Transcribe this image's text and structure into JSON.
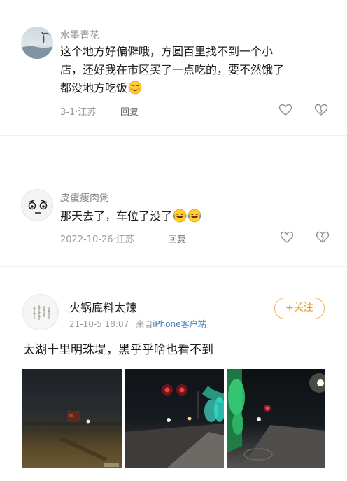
{
  "comments": [
    {
      "username": "水墨青花",
      "text_line1": "这个地方好偏僻哦，方圆百里找不到一个小",
      "text_line2": "店，还好我在市区买了一点吃的，要不然饿了",
      "text_line3": "都没地方吃饭",
      "date": "3-1",
      "location": "江苏",
      "reply_label": "回复",
      "emoji": "blush-face-emoji"
    },
    {
      "username": "皮蛋瘦肉粥",
      "text": "那天去了，车位了没了",
      "date": "2022-10-26",
      "location": "江苏",
      "reply_label": "回复",
      "emoji": "laughing-crying-face-emoji"
    }
  ],
  "post": {
    "username": "火锅底料太辣",
    "timestamp": "21-10-5 18:07",
    "source_prefix": "来自",
    "source": "iPhone客户端",
    "follow_label": "+关注",
    "text": "太湖十里明珠堤，黑乎乎啥也看不到",
    "photos": [
      "night-lake-photo",
      "red-traffic-light-road-photo",
      "green-lit-walkway-photo"
    ]
  },
  "colors": {
    "meta_gray": "#9a9a9a",
    "follow_orange": "#e8941d",
    "link_blue": "#4a7fb8"
  }
}
